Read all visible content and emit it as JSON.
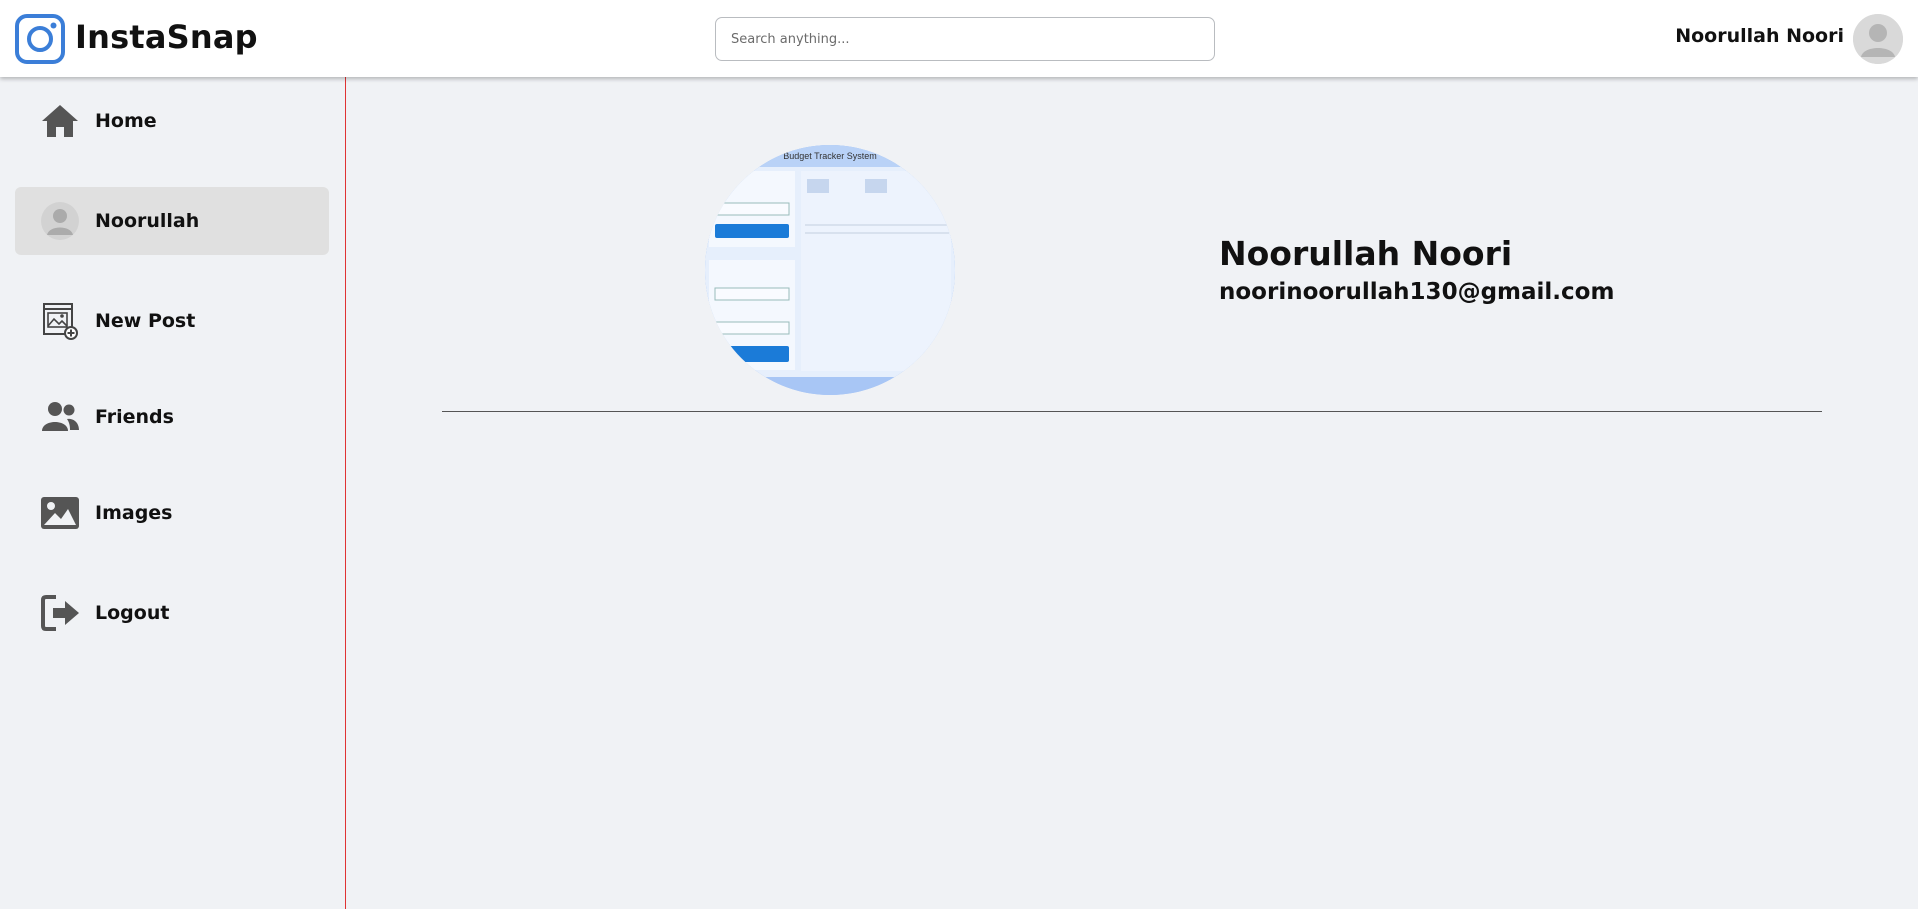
{
  "app": {
    "brand": "InstaSnap",
    "logo_icon": "instagram-camera-icon",
    "accent_color": "#3b7ed8"
  },
  "header": {
    "search_placeholder": "Search anything...",
    "search_value": "",
    "user_name": "Noorullah Noori",
    "avatar_icon": "user-avatar-icon"
  },
  "sidebar": {
    "items": [
      {
        "label": "Home",
        "icon": "home-icon",
        "active": false
      },
      {
        "label": "Noorullah",
        "icon": "user-avatar-icon",
        "active": true
      },
      {
        "label": "New Post",
        "icon": "add-image-icon",
        "active": false
      },
      {
        "label": "Friends",
        "icon": "users-icon",
        "active": false
      },
      {
        "label": "Images",
        "icon": "image-icon",
        "active": false
      },
      {
        "label": "Logout",
        "icon": "logout-icon",
        "active": false
      }
    ]
  },
  "profile": {
    "name": "Noorullah Noori",
    "email": "noorinoorullah130@gmail.com",
    "photo_screenshot_title": "Budget Tracker System"
  }
}
